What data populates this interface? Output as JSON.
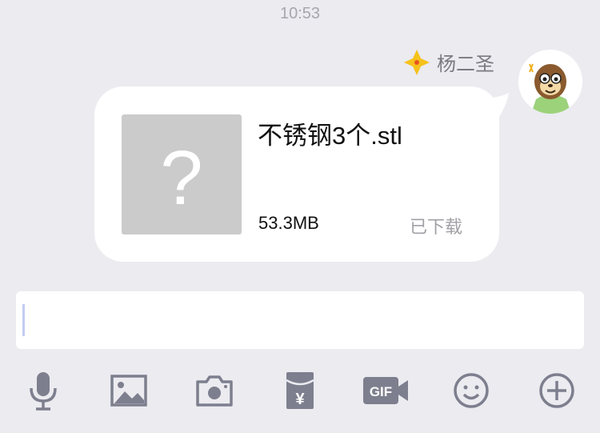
{
  "chat": {
    "timestamp": "10:53",
    "sender_name": "杨二圣",
    "badge_icon": "yellow-diamond-star-icon",
    "avatar_icon": "cartoon-sloth-avatar"
  },
  "message": {
    "file_name": "不锈钢3个.stl",
    "file_size": "53.3MB",
    "status": "已下载",
    "thumb_glyph": "?"
  },
  "input": {
    "value": ""
  },
  "toolbar": {
    "icons": [
      "microphone-icon",
      "image-icon",
      "camera-icon",
      "red-packet-yen-icon",
      "gif-icon",
      "emoji-icon",
      "plus-icon"
    ],
    "gif_label": "GIF",
    "yen_symbol": "¥"
  },
  "colors": {
    "background": "#ebebf0",
    "bubble": "#ffffff",
    "icon_gray": "#7d7f8e",
    "badge_yellow": "#f6c21b"
  }
}
